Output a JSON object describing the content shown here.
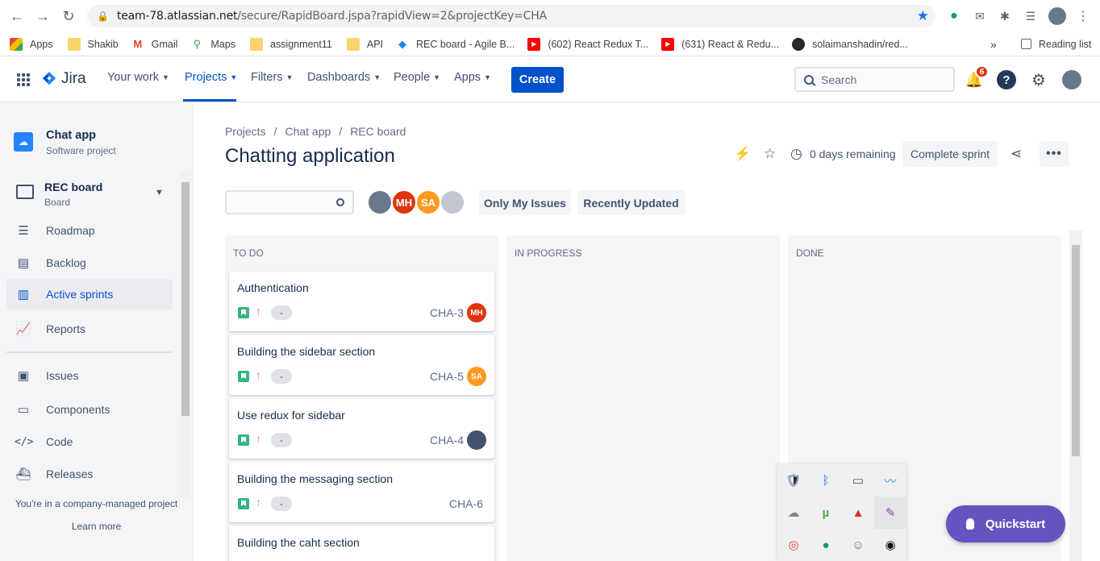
{
  "browser": {
    "url_host": "team-78.atlassian.net",
    "url_path": "/secure/RapidBoard.jspa?rapidView=2&projectKey=CHA",
    "bookmarks": [
      {
        "label": "Apps",
        "icon": "apps-grid-icon"
      },
      {
        "label": "Shakib",
        "icon": "folder-icon"
      },
      {
        "label": "Gmail",
        "icon": "gmail-icon"
      },
      {
        "label": "Maps",
        "icon": "maps-icon"
      },
      {
        "label": "assignment11",
        "icon": "folder-icon"
      },
      {
        "label": "API",
        "icon": "folder-icon"
      },
      {
        "label": "REC board - Agile B...",
        "icon": "jira-icon"
      },
      {
        "label": "(602) React Redux T...",
        "icon": "youtube-icon"
      },
      {
        "label": "(631) React & Redu...",
        "icon": "youtube-icon"
      },
      {
        "label": "solaimanshadin/red...",
        "icon": "github-icon"
      }
    ],
    "more_label": "»",
    "reading_list": "Reading list"
  },
  "jira_nav": {
    "logo": "Jira",
    "items": [
      "Your work",
      "Projects",
      "Filters",
      "Dashboards",
      "People",
      "Apps"
    ],
    "create": "Create",
    "search_placeholder": "Search",
    "notification_count": "6"
  },
  "sidebar": {
    "project_name": "Chat app",
    "project_type": "Software project",
    "board_name": "REC board",
    "board_type": "Board",
    "items": [
      {
        "label": "Roadmap",
        "icon": "roadmap-icon"
      },
      {
        "label": "Backlog",
        "icon": "backlog-icon"
      },
      {
        "label": "Active sprints",
        "icon": "board-icon"
      },
      {
        "label": "Reports",
        "icon": "reports-icon"
      },
      {
        "label": "Issues",
        "icon": "issues-icon"
      },
      {
        "label": "Components",
        "icon": "components-icon"
      },
      {
        "label": "Code",
        "icon": "code-icon"
      },
      {
        "label": "Releases",
        "icon": "releases-icon"
      }
    ],
    "footer": "You're in a company-managed project",
    "learn_more": "Learn more"
  },
  "breadcrumb": [
    "Projects",
    "/",
    "Chat app",
    "/",
    "REC board"
  ],
  "page_title": "Chatting application",
  "sprint": {
    "days_remaining": "0 days remaining",
    "complete": "Complete sprint",
    "more": "•••"
  },
  "filters": {
    "avatars": [
      "",
      "MH",
      "SA",
      ""
    ],
    "only_my_issues": "Only My Issues",
    "recently_updated": "Recently Updated"
  },
  "columns": [
    {
      "name": "TO DO"
    },
    {
      "name": "IN PROGRESS"
    },
    {
      "name": "DONE"
    }
  ],
  "cards": [
    {
      "title": "Authentication",
      "key": "CHA-3",
      "estimate": "-",
      "assignee": "MH",
      "assignee_color": "#de350b"
    },
    {
      "title": "Building the sidebar section",
      "key": "CHA-5",
      "estimate": "-",
      "assignee": "SA",
      "assignee_color": "#ff991f"
    },
    {
      "title": "Use redux for sidebar",
      "key": "CHA-4",
      "estimate": "-",
      "assignee": "",
      "assignee_color": "#42526e"
    },
    {
      "title": "Building the messaging section",
      "key": "CHA-6",
      "estimate": "-",
      "assignee": "",
      "assignee_color": ""
    },
    {
      "title": "Building the caht section",
      "key": "",
      "estimate": "",
      "assignee": "",
      "assignee_color": ""
    }
  ],
  "quickstart": "Quickstart",
  "colors": {
    "primary": "#0052cc",
    "quickstart": "#6554c0",
    "story": "#36b37e",
    "priority": "#ff7452"
  }
}
